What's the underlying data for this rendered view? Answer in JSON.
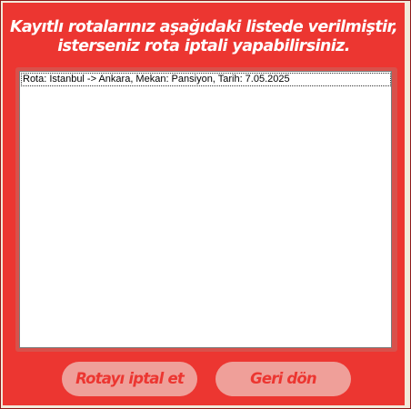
{
  "header": {
    "line1": "Kayıtlı rotalarınız aşağıdaki listede verilmiştir,",
    "line2": "isterseniz rota iptali yapabilirsiniz."
  },
  "routes_list": {
    "items": [
      "Rota: Istanbul -> Ankara, Mekan: Pansiyon, Tarih: 7.05.2025"
    ]
  },
  "buttons": {
    "cancel_route": "Rotayı iptal et",
    "go_back": "Geri dön"
  },
  "colors": {
    "panel_bg": "#ec3631",
    "button_bg": "#ef9f99",
    "button_text": "#ec3631",
    "heading_text": "#ffffff"
  }
}
